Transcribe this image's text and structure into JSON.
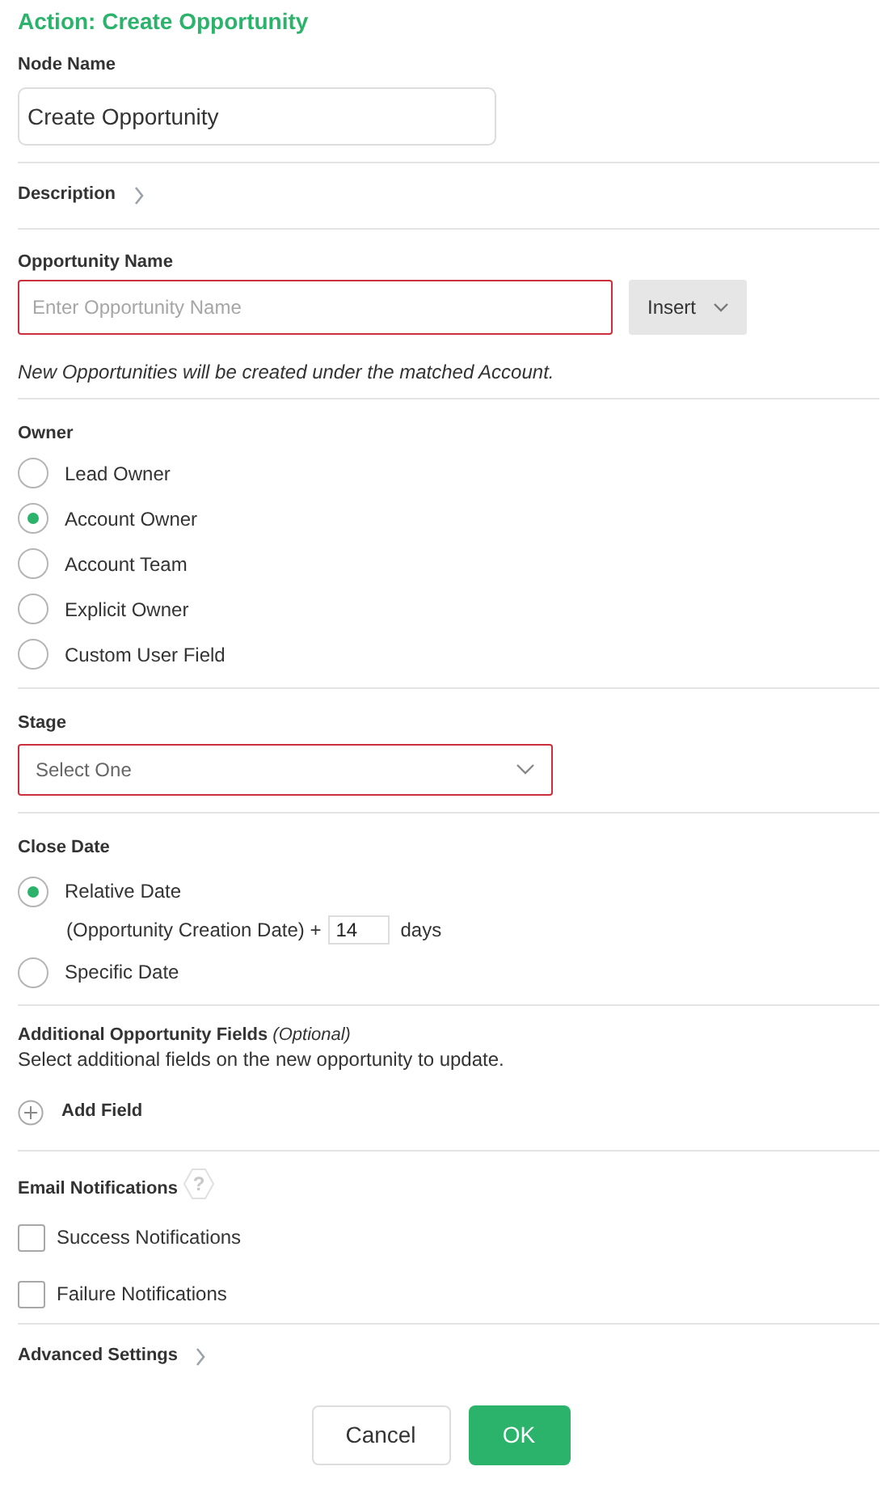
{
  "title": "Action: Create Opportunity",
  "node_name": {
    "label": "Node Name",
    "value": "Create Opportunity"
  },
  "description": {
    "label": "Description",
    "expanded": false
  },
  "opportunity_name": {
    "label": "Opportunity Name",
    "placeholder": "Enter Opportunity Name",
    "insert_button": "Insert",
    "note": "New Opportunities will be created under the matched Account."
  },
  "owner": {
    "label": "Owner",
    "options": [
      {
        "label": "Lead Owner",
        "selected": false
      },
      {
        "label": "Account Owner",
        "selected": true
      },
      {
        "label": "Account Team",
        "selected": false
      },
      {
        "label": "Explicit Owner",
        "selected": false
      },
      {
        "label": "Custom User Field",
        "selected": false
      }
    ]
  },
  "stage": {
    "label": "Stage",
    "placeholder": "Select One"
  },
  "close_date": {
    "label": "Close Date",
    "options": [
      {
        "label": "Relative Date",
        "selected": true,
        "prefix": "(Opportunity Creation Date) +",
        "value": "14",
        "suffix": "days"
      },
      {
        "label": "Specific Date",
        "selected": false
      }
    ]
  },
  "additional_fields": {
    "label": "Additional Opportunity Fields",
    "optional": "(Optional)",
    "hint": "Select additional fields on the new opportunity to update.",
    "add_button": "Add Field"
  },
  "email_notifications": {
    "label": "Email Notifications",
    "help": "?",
    "options": [
      {
        "label": "Success Notifications",
        "checked": false
      },
      {
        "label": "Failure Notifications",
        "checked": false
      }
    ]
  },
  "advanced_settings": {
    "label": "Advanced Settings",
    "expanded": false
  },
  "buttons": {
    "cancel": "Cancel",
    "ok": "OK"
  }
}
